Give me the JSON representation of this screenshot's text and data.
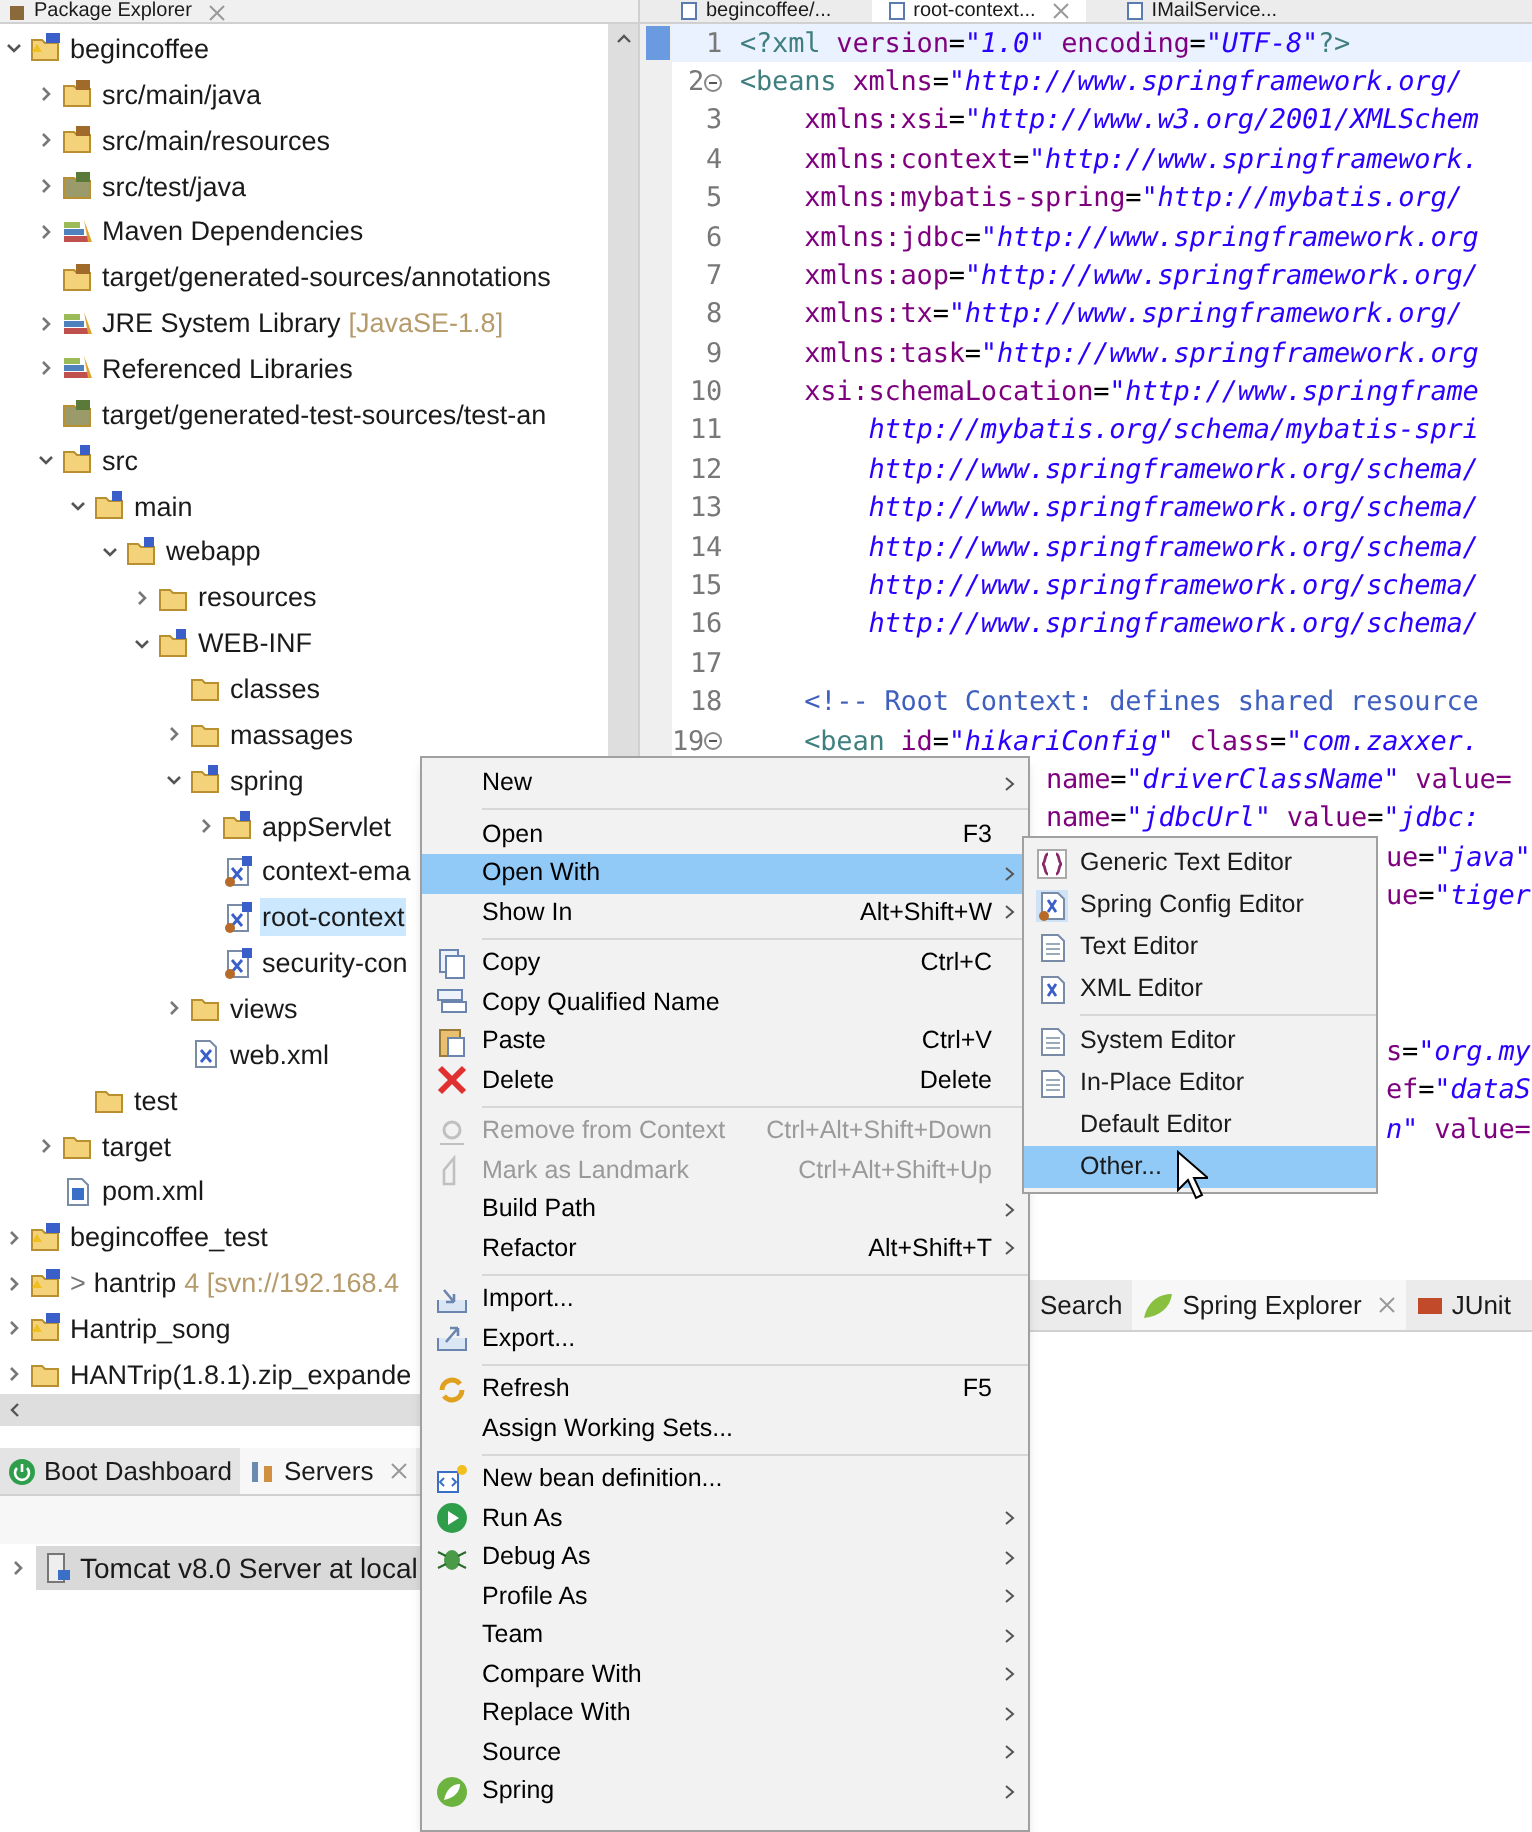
{
  "package_explorer": {
    "title": "Package Explorer",
    "tree": [
      {
        "label": "begincoffee",
        "kind": "project",
        "expanded": true,
        "selected": false,
        "children": [
          {
            "label": "src/main/java",
            "kind": "source-folder",
            "expanded": false,
            "selected": false
          },
          {
            "label": "src/main/resources",
            "kind": "source-folder",
            "expanded": false,
            "selected": false
          },
          {
            "label": "src/test/java",
            "kind": "test-folder",
            "expanded": false,
            "selected": false
          },
          {
            "label": "Maven Dependencies",
            "kind": "library",
            "expanded": false,
            "selected": false
          },
          {
            "label": "target/generated-sources/annotations",
            "kind": "source-folder",
            "selected": false
          },
          {
            "label": "JRE System Library",
            "decoration": "[JavaSE-1.8]",
            "kind": "library",
            "expanded": false,
            "selected": false
          },
          {
            "label": "Referenced Libraries",
            "kind": "library",
            "expanded": false,
            "selected": false
          },
          {
            "label": "target/generated-test-sources/test-an",
            "kind": "test-folder",
            "selected": false
          },
          {
            "label": "src",
            "kind": "spring-folder",
            "expanded": true,
            "selected": false,
            "children": [
              {
                "label": "main",
                "kind": "spring-folder",
                "expanded": true,
                "selected": false,
                "children": [
                  {
                    "label": "webapp",
                    "kind": "spring-folder",
                    "expanded": true,
                    "selected": false,
                    "children": [
                      {
                        "label": "resources",
                        "kind": "folder",
                        "expanded": false,
                        "selected": false
                      },
                      {
                        "label": "WEB-INF",
                        "kind": "spring-folder",
                        "expanded": true,
                        "selected": false,
                        "children": [
                          {
                            "label": "classes",
                            "kind": "folder",
                            "selected": false
                          },
                          {
                            "label": "massages",
                            "kind": "folder",
                            "expanded": false,
                            "selected": false
                          },
                          {
                            "label": "spring",
                            "kind": "spring-folder",
                            "expanded": true,
                            "selected": false,
                            "children": [
                              {
                                "label": "appServlet",
                                "kind": "spring-folder",
                                "expanded": false,
                                "selected": false
                              },
                              {
                                "label": "context-ema",
                                "kind": "spring-xml",
                                "selected": false
                              },
                              {
                                "label": "root-context",
                                "kind": "spring-xml",
                                "selected": true
                              },
                              {
                                "label": "security-con",
                                "kind": "spring-xml",
                                "selected": false
                              }
                            ]
                          },
                          {
                            "label": "views",
                            "kind": "folder",
                            "expanded": false,
                            "selected": false
                          },
                          {
                            "label": "web.xml",
                            "kind": "xml",
                            "selected": false
                          }
                        ]
                      }
                    ]
                  }
                ]
              },
              {
                "label": "test",
                "kind": "folder",
                "selected": false
              }
            ]
          },
          {
            "label": "target",
            "kind": "folder",
            "expanded": false,
            "selected": false
          },
          {
            "label": "pom.xml",
            "kind": "pom",
            "selected": false
          }
        ]
      },
      {
        "label": "begincoffee_test",
        "kind": "project",
        "expanded": false,
        "selected": false
      },
      {
        "prefix": ">",
        "label": "hantrip",
        "decoration": "4 [svn://192.168.4",
        "kind": "project",
        "expanded": false,
        "selected": false
      },
      {
        "label": "Hantrip_song",
        "kind": "project",
        "expanded": false,
        "selected": false
      },
      {
        "label": "HANTrip(1.8.1).zip_expande",
        "kind": "folder",
        "expanded": false,
        "selected": false
      }
    ]
  },
  "editor": {
    "tabs": [
      {
        "label": "begincoffee/...",
        "selected": false
      },
      {
        "label": "root-context...",
        "selected": true
      },
      {
        "label": "IMailService...",
        "selected": false
      }
    ],
    "lines": [
      {
        "number": "1",
        "kind": "full",
        "segments": [
          {
            "text": "<?xml",
            "kind": "tag"
          },
          {
            "text": " version",
            "kind": "attr"
          },
          {
            "text": "=",
            "kind": "plain"
          },
          {
            "text": "\"1.0\"",
            "kind": "string"
          },
          {
            "text": " encoding",
            "kind": "attr"
          },
          {
            "text": "=",
            "kind": "plain"
          },
          {
            "text": "\"UTF-8\"",
            "kind": "string"
          },
          {
            "text": "?>",
            "kind": "tag"
          }
        ]
      },
      {
        "number": "2",
        "fold": true,
        "kind": "full",
        "segments": [
          {
            "text": "<beans",
            "kind": "tag"
          },
          {
            "text": " xmlns",
            "kind": "attr"
          },
          {
            "text": "=",
            "kind": "plain"
          },
          {
            "text": "\"http://www.springframework.org/",
            "kind": "string"
          }
        ]
      },
      {
        "number": "3",
        "kind": "full",
        "segments": [
          {
            "text": "    xmlns:xsi",
            "kind": "attr"
          },
          {
            "text": "=",
            "kind": "plain"
          },
          {
            "text": "\"http://www.w3.org/2001/XMLSchem",
            "kind": "string"
          }
        ]
      },
      {
        "number": "4",
        "kind": "full",
        "segments": [
          {
            "text": "    xmlns:context",
            "kind": "attr"
          },
          {
            "text": "=",
            "kind": "plain"
          },
          {
            "text": "\"http://www.springframework.",
            "kind": "string"
          }
        ]
      },
      {
        "number": "5",
        "kind": "full",
        "segments": [
          {
            "text": "    xmlns:mybatis-spring",
            "kind": "attr"
          },
          {
            "text": "=",
            "kind": "plain"
          },
          {
            "text": "\"http://mybatis.org/",
            "kind": "string"
          }
        ]
      },
      {
        "number": "6",
        "kind": "full",
        "segments": [
          {
            "text": "    xmlns:jdbc",
            "kind": "attr"
          },
          {
            "text": "=",
            "kind": "plain"
          },
          {
            "text": "\"http://www.springframework.org",
            "kind": "string"
          }
        ]
      },
      {
        "number": "7",
        "kind": "full",
        "segments": [
          {
            "text": "    xmlns:aop",
            "kind": "attr"
          },
          {
            "text": "=",
            "kind": "plain"
          },
          {
            "text": "\"http://www.springframework.org/",
            "kind": "string"
          }
        ]
      },
      {
        "number": "8",
        "kind": "full",
        "segments": [
          {
            "text": "    xmlns:tx",
            "kind": "attr"
          },
          {
            "text": "=",
            "kind": "plain"
          },
          {
            "text": "\"http://www.springframework.org/",
            "kind": "string"
          }
        ]
      },
      {
        "number": "9",
        "kind": "full",
        "segments": [
          {
            "text": "    xmlns:task",
            "kind": "attr"
          },
          {
            "text": "=",
            "kind": "plain"
          },
          {
            "text": "\"http://www.springframework.org",
            "kind": "string"
          }
        ]
      },
      {
        "number": "10",
        "kind": "full",
        "segments": [
          {
            "text": "    xsi:schemaLocation",
            "kind": "attr"
          },
          {
            "text": "=",
            "kind": "plain"
          },
          {
            "text": "\"http://www.springframe",
            "kind": "string"
          }
        ]
      },
      {
        "number": "11",
        "kind": "full",
        "segments": [
          {
            "text": "        http://mybatis.org/schema/mybatis-spri",
            "kind": "string"
          }
        ]
      },
      {
        "number": "12",
        "kind": "full",
        "segments": [
          {
            "text": "        http://www.springframework.org/schema/",
            "kind": "string"
          }
        ]
      },
      {
        "number": "13",
        "kind": "full",
        "segments": [
          {
            "text": "        http://www.springframework.org/schema/",
            "kind": "string"
          }
        ]
      },
      {
        "number": "14",
        "kind": "full",
        "segments": [
          {
            "text": "        http://www.springframework.org/schema/",
            "kind": "string"
          }
        ]
      },
      {
        "number": "15",
        "kind": "full",
        "segments": [
          {
            "text": "        http://www.springframework.org/schema/",
            "kind": "string"
          }
        ]
      },
      {
        "number": "16",
        "kind": "full",
        "segments": [
          {
            "text": "        http://www.springframework.org/schema/",
            "kind": "string"
          }
        ]
      },
      {
        "number": "17",
        "kind": "full"
      },
      {
        "number": "18",
        "kind": "full",
        "segments": [
          {
            "text": "    <!-- Root Context: defines shared resource",
            "kind": "comment"
          }
        ]
      },
      {
        "number": "19",
        "fold": true,
        "kind": "full",
        "segments": [
          {
            "text": "    <bean",
            "kind": "tag"
          },
          {
            "text": " id",
            "kind": "attr"
          },
          {
            "text": "=",
            "kind": "plain"
          },
          {
            "text": "\"hikariConfig\"",
            "kind": "string"
          },
          {
            "text": " class",
            "kind": "attr"
          },
          {
            "text": "=",
            "kind": "plain"
          },
          {
            "text": "\"com.zaxxer.",
            "kind": "string"
          }
        ]
      },
      {
        "kind": "behind-menu",
        "segments": [
          {
            "text": "name",
            "kind": "attr"
          },
          {
            "text": "=",
            "kind": "plain"
          },
          {
            "text": "\"driverClassName\"",
            "kind": "string"
          },
          {
            "text": " value=",
            "kind": "attr"
          }
        ]
      },
      {
        "kind": "behind-menu",
        "segments": [
          {
            "text": "name",
            "kind": "attr"
          },
          {
            "text": "=",
            "kind": "plain"
          },
          {
            "text": "\"jdbcUrl\"",
            "kind": "string"
          },
          {
            "text": " value",
            "kind": "attr"
          },
          {
            "text": "=",
            "kind": "plain"
          },
          {
            "text": "\"jdbc:",
            "kind": "string"
          }
        ]
      },
      {
        "kind": "behind-submenu",
        "segments": [
          {
            "text": "ue",
            "kind": "attr"
          },
          {
            "text": "=",
            "kind": "plain"
          },
          {
            "text": "\"java\"",
            "kind": "string"
          }
        ]
      },
      {
        "kind": "behind-submenu",
        "segments": [
          {
            "text": "ue",
            "kind": "attr"
          },
          {
            "text": "=",
            "kind": "plain"
          },
          {
            "text": "\"tiger",
            "kind": "string"
          }
        ]
      },
      {
        "kind": "covered"
      },
      {
        "kind": "covered"
      },
      {
        "kind": "covered"
      },
      {
        "kind": "behind-submenu",
        "segments": [
          {
            "text": "s",
            "kind": "attr"
          },
          {
            "text": "=",
            "kind": "plain"
          },
          {
            "text": "\"org.my",
            "kind": "string"
          }
        ]
      },
      {
        "kind": "behind-submenu",
        "segments": [
          {
            "text": "ef",
            "kind": "attr"
          },
          {
            "text": "=",
            "kind": "plain"
          },
          {
            "text": "\"dataS",
            "kind": "string"
          }
        ]
      },
      {
        "kind": "behind-submenu",
        "segments": [
          {
            "text": "n\"",
            "kind": "string"
          },
          {
            "text": " value=",
            "kind": "attr"
          }
        ]
      }
    ]
  },
  "bottom_left": {
    "tabs": [
      {
        "label": "Boot Dashboard",
        "selected": false
      },
      {
        "label": "Servers",
        "selected": true
      }
    ],
    "servers": [
      {
        "label": "Tomcat v8.0 Server at local",
        "expanded": false,
        "selected": true
      }
    ]
  },
  "bottom_right": {
    "tabs": [
      {
        "label": "Search",
        "selected": false
      },
      {
        "label": "Spring Explorer",
        "selected": true
      },
      {
        "label": "JUnit",
        "selected": false
      }
    ]
  },
  "context_menu": {
    "items": [
      {
        "kind": "item",
        "label": "New",
        "submenu": true,
        "disabled": false,
        "selected": false
      },
      {
        "kind": "separator"
      },
      {
        "kind": "item",
        "label": "Open",
        "shortcut": "F3",
        "submenu": false,
        "disabled": false,
        "selected": false
      },
      {
        "kind": "item",
        "label": "Open With",
        "submenu": true,
        "disabled": false,
        "selected": true
      },
      {
        "kind": "item",
        "label": "Show In",
        "shortcut": "Alt+Shift+W",
        "submenu": true,
        "disabled": false,
        "selected": false
      },
      {
        "kind": "separator"
      },
      {
        "kind": "item",
        "label": "Copy",
        "shortcut": "Ctrl+C",
        "submenu": false,
        "disabled": false,
        "selected": false
      },
      {
        "kind": "item",
        "label": "Copy Qualified Name",
        "submenu": false,
        "disabled": false,
        "selected": false
      },
      {
        "kind": "item",
        "label": "Paste",
        "shortcut": "Ctrl+V",
        "submenu": false,
        "disabled": false,
        "selected": false
      },
      {
        "kind": "item",
        "label": "Delete",
        "shortcut": "Delete",
        "submenu": false,
        "disabled": false,
        "selected": false
      },
      {
        "kind": "separator"
      },
      {
        "kind": "item",
        "label": "Remove from Context",
        "shortcut": "Ctrl+Alt+Shift+Down",
        "submenu": false,
        "disabled": true,
        "selected": false
      },
      {
        "kind": "item",
        "label": "Mark as Landmark",
        "shortcut": "Ctrl+Alt+Shift+Up",
        "submenu": false,
        "disabled": true,
        "selected": false
      },
      {
        "kind": "item",
        "label": "Build Path",
        "submenu": true,
        "disabled": false,
        "selected": false
      },
      {
        "kind": "item",
        "label": "Refactor",
        "shortcut": "Alt+Shift+T",
        "submenu": true,
        "disabled": false,
        "selected": false
      },
      {
        "kind": "separator"
      },
      {
        "kind": "item",
        "label": "Import...",
        "submenu": false,
        "disabled": false,
        "selected": false
      },
      {
        "kind": "item",
        "label": "Export...",
        "submenu": false,
        "disabled": false,
        "selected": false
      },
      {
        "kind": "separator"
      },
      {
        "kind": "item",
        "label": "Refresh",
        "shortcut": "F5",
        "submenu": false,
        "disabled": false,
        "selected": false
      },
      {
        "kind": "item",
        "label": "Assign Working Sets...",
        "submenu": false,
        "disabled": false,
        "selected": false
      },
      {
        "kind": "separator"
      },
      {
        "kind": "item",
        "label": "New bean definition...",
        "submenu": false,
        "disabled": false,
        "selected": false
      },
      {
        "kind": "item",
        "label": "Run As",
        "submenu": true,
        "disabled": false,
        "selected": false
      },
      {
        "kind": "item",
        "label": "Debug As",
        "submenu": true,
        "disabled": false,
        "selected": false
      },
      {
        "kind": "item",
        "label": "Profile As",
        "submenu": true,
        "disabled": false,
        "selected": false
      },
      {
        "kind": "item",
        "label": "Team",
        "submenu": true,
        "disabled": false,
        "selected": false
      },
      {
        "kind": "item",
        "label": "Compare With",
        "submenu": true,
        "disabled": false,
        "selected": false
      },
      {
        "kind": "item",
        "label": "Replace With",
        "submenu": true,
        "disabled": false,
        "selected": false
      },
      {
        "kind": "item",
        "label": "Source",
        "submenu": true,
        "disabled": false,
        "selected": false
      },
      {
        "kind": "item",
        "label": "Spring",
        "submenu": true,
        "disabled": false,
        "selected": false
      }
    ]
  },
  "open_with_submenu": {
    "items": [
      {
        "kind": "item",
        "label": "Generic Text Editor",
        "selected": false
      },
      {
        "kind": "item",
        "label": "Spring Config Editor",
        "selected": false
      },
      {
        "kind": "item",
        "label": "Text Editor",
        "selected": false
      },
      {
        "kind": "item",
        "label": "XML Editor",
        "selected": false
      },
      {
        "kind": "separator"
      },
      {
        "kind": "item",
        "label": "System Editor",
        "selected": false
      },
      {
        "kind": "item",
        "label": "In-Place Editor",
        "selected": false
      },
      {
        "kind": "item",
        "label": "Default Editor",
        "selected": false
      },
      {
        "kind": "item",
        "label": "Other...",
        "selected": true
      }
    ]
  }
}
